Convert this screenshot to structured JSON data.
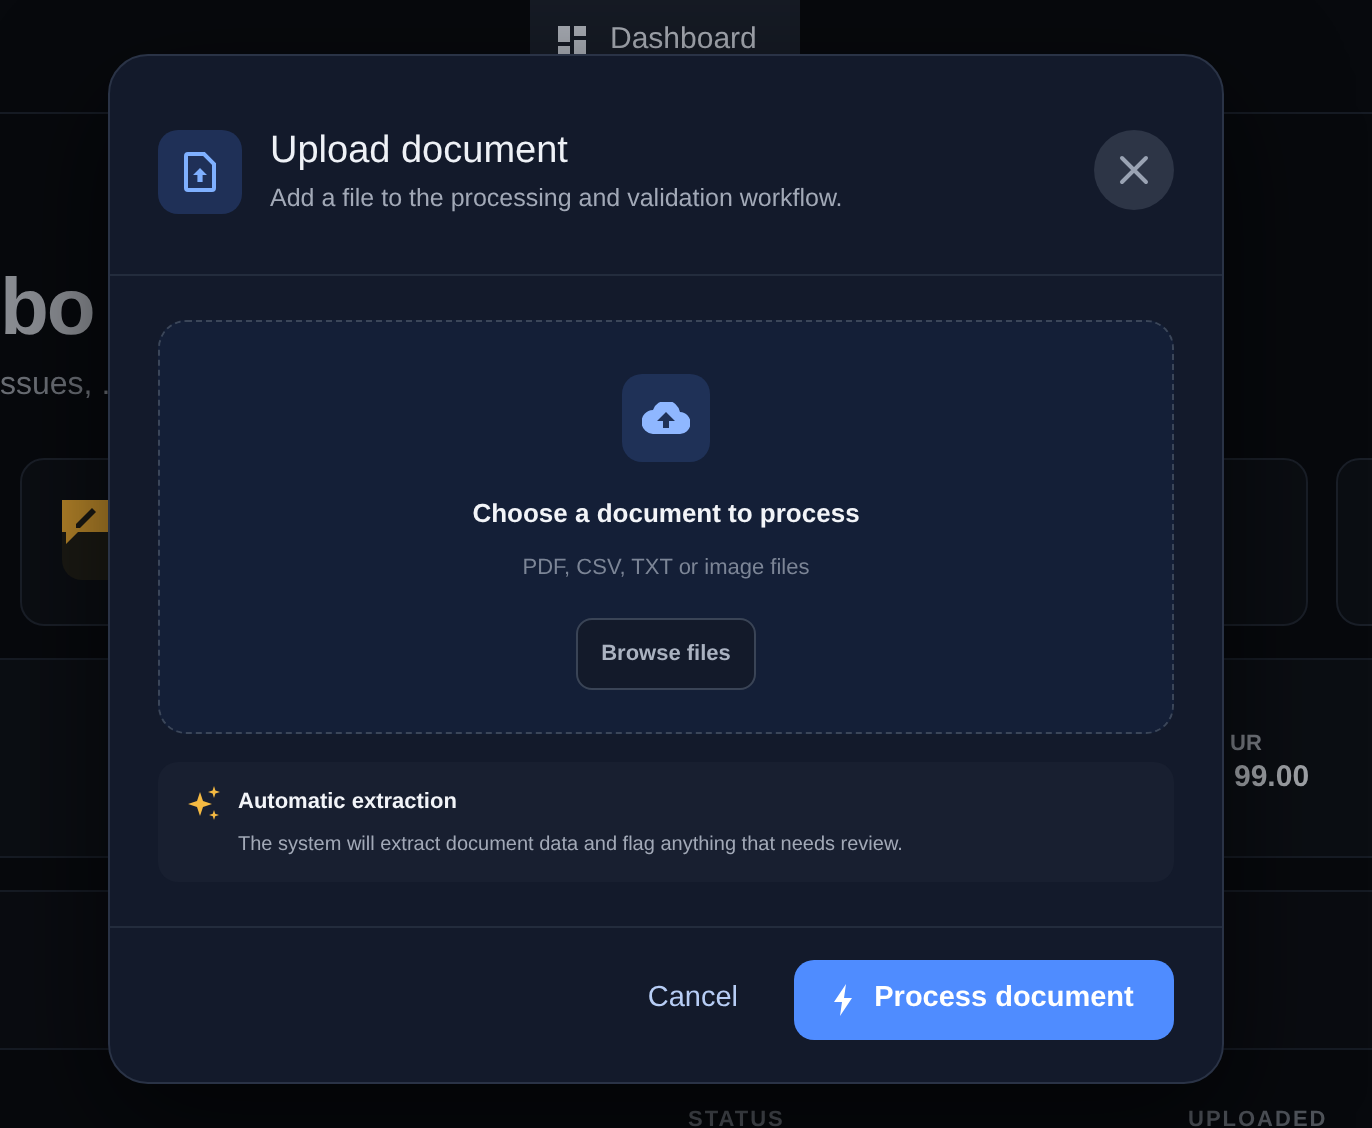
{
  "topbar": {
    "tab": {
      "label": "Dashboard"
    }
  },
  "page": {
    "heading": "bo",
    "subtitle": "ssues, .",
    "amount": {
      "currency": "UR",
      "value": "99.00"
    },
    "table": {
      "columns": [
        "STATUS",
        "UPLOADED"
      ]
    }
  },
  "dialog": {
    "title": "Upload document",
    "subtitle": "Add a file to the processing and validation workflow.",
    "dropzone": {
      "title": "Choose a document to process",
      "hint": "PDF, CSV, TXT or image files",
      "button": "Browse files"
    },
    "notice": {
      "title": "Automatic extraction",
      "text": "The system will extract document data and flag anything that needs review."
    },
    "buttons": [
      {
        "label": "Cancel",
        "kind": "link"
      },
      {
        "label": "Process document",
        "kind": "primary"
      }
    ]
  }
}
